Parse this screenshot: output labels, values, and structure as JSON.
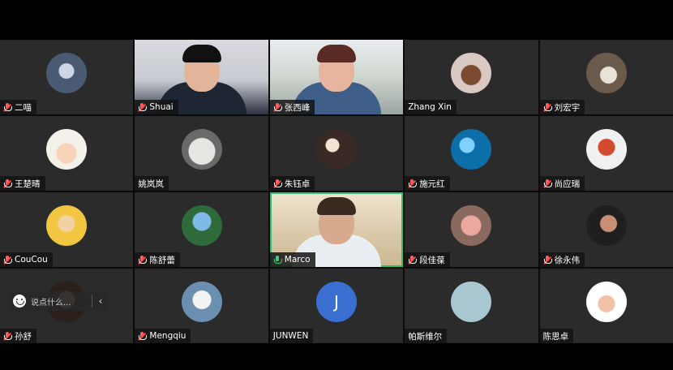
{
  "participants": [
    {
      "name": "二喵",
      "mic": "muted"
    },
    {
      "name": "Shuai",
      "mic": "muted"
    },
    {
      "name": "张西峰",
      "mic": "muted"
    },
    {
      "name": "Zhang Xin",
      "mic": "none"
    },
    {
      "name": "刘宏宇",
      "mic": "muted"
    },
    {
      "name": "王楚晴",
      "mic": "muted"
    },
    {
      "name": "姚岚岚",
      "mic": "none"
    },
    {
      "name": "朱钰卓",
      "mic": "muted"
    },
    {
      "name": "施元红",
      "mic": "muted"
    },
    {
      "name": "尚应瑞",
      "mic": "muted"
    },
    {
      "name": "CouCou",
      "mic": "muted"
    },
    {
      "name": "陈舒蕾",
      "mic": "muted"
    },
    {
      "name": "Marco",
      "mic": "active"
    },
    {
      "name": "段佳葆",
      "mic": "muted"
    },
    {
      "name": "徐永伟",
      "mic": "muted"
    },
    {
      "name": "孙舒",
      "mic": "muted"
    },
    {
      "name": "Mengqiu",
      "mic": "muted"
    },
    {
      "name": "JUNWEN",
      "mic": "none"
    },
    {
      "name": "帕斯维尔",
      "mic": "none"
    },
    {
      "name": "陈思卓",
      "mic": "none"
    }
  ],
  "tiles": {
    "t11_avatar_letter": "J"
  },
  "chat": {
    "placeholder": "说点什么...",
    "collapse_glyph": "‹"
  },
  "colors": {
    "speaking": "#2fbf71",
    "tile_bg": "#2b2b2b",
    "muted_red": "#ff4d4d"
  }
}
